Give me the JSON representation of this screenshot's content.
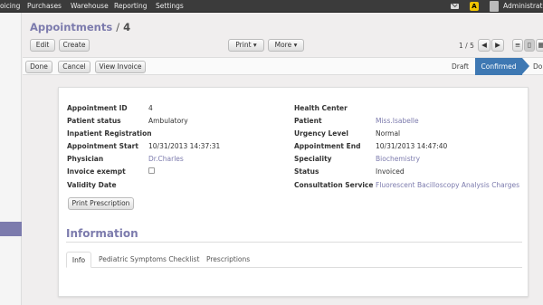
{
  "topnav": {
    "items": [
      "oicing",
      "Purchases",
      "Warehouse",
      "Reporting",
      "Settings"
    ],
    "user": "Administrator",
    "alert_glyph": "A",
    "icons": [
      "mail-icon",
      "alert-icon",
      "avatar"
    ]
  },
  "header": {
    "breadcrumb_parent": "Appointments",
    "breadcrumb_sep": "/",
    "breadcrumb_current": "4",
    "edit_label": "Edit",
    "create_label": "Create",
    "print_label": "Print",
    "more_label": "More",
    "pager": "1 / 5"
  },
  "statusbar": {
    "done_label": "Done",
    "cancel_label": "Cancel",
    "view_invoice_label": "View Invoice",
    "stages": [
      "Draft",
      "Confirmed",
      "Do"
    ],
    "active_stage": "Confirmed",
    "active_color": "#3e78b3"
  },
  "form": {
    "left": [
      {
        "label": "Appointment ID",
        "value": "4"
      },
      {
        "label": "Patient status",
        "value": "Ambulatory"
      },
      {
        "label": "Inpatient Registration",
        "value": ""
      },
      {
        "label": "Appointment Start",
        "value": "10/31/2013 14:37:31"
      },
      {
        "label": "Physician",
        "value": "Dr.Charles"
      },
      {
        "label": "Invoice exempt",
        "value": ""
      },
      {
        "label": "Validity Date",
        "value": ""
      }
    ],
    "right": [
      {
        "label": "Health Center",
        "value": ""
      },
      {
        "label": "Patient",
        "value": "Miss.Isabelle"
      },
      {
        "label": "Urgency Level",
        "value": "Normal"
      },
      {
        "label": "Appointment End",
        "value": "10/31/2013 14:47:40"
      },
      {
        "label": "Speciality",
        "value": "Biochemistry"
      },
      {
        "label": "Status",
        "value": "Invoiced"
      },
      {
        "label": "Consultation Service",
        "value": "Fluorescent Bacilloscopy Analysis Charges"
      }
    ],
    "print_prescription_label": "Print Prescription",
    "link_color": "#7c7bad"
  },
  "info": {
    "title": "Information",
    "tabs": [
      "Info",
      "Pediatric Symptoms Checklist",
      "Prescriptions"
    ],
    "active_tab": "Info"
  }
}
